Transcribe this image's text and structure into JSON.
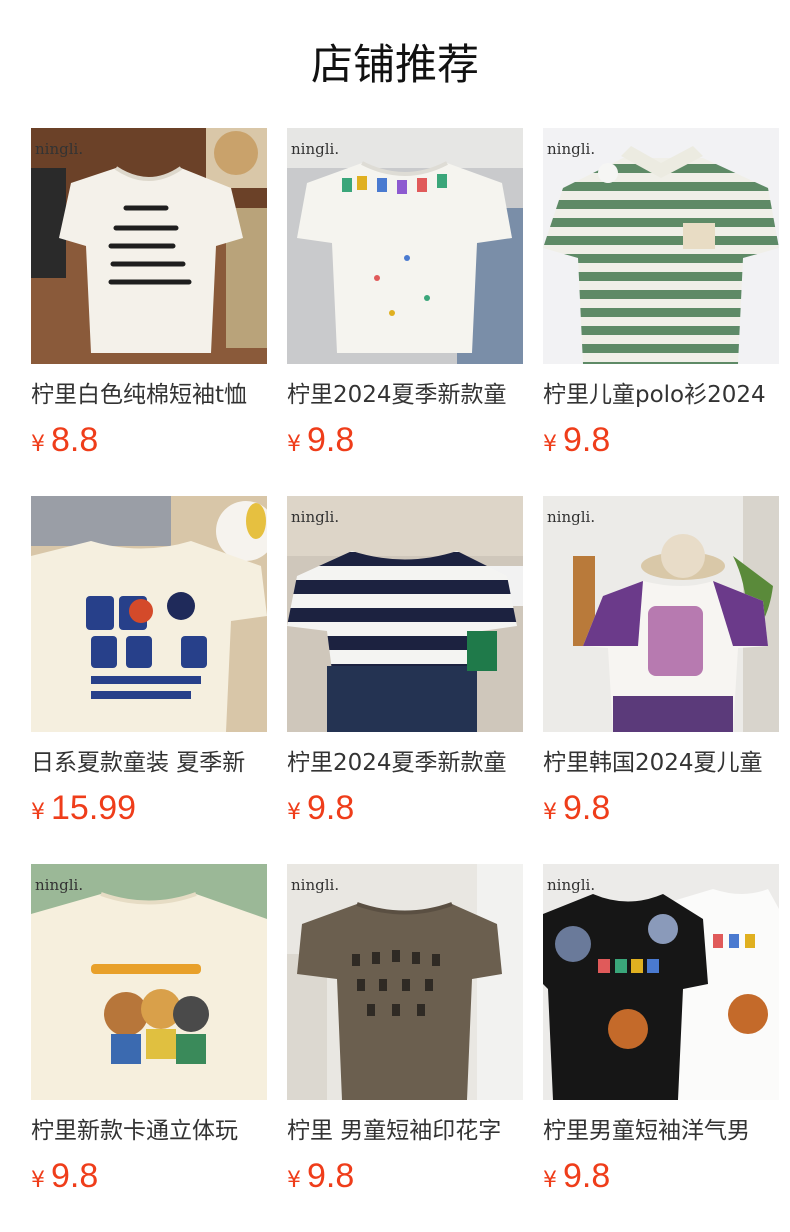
{
  "header": {
    "title": "店铺推荐"
  },
  "brand_mark": "ningli.",
  "currency": "¥",
  "products": [
    {
      "name": "柠里白色纯棉短袖t恤",
      "price": "8.8",
      "image": "white tee with chinese calligraphy"
    },
    {
      "name": "柠里2024夏季新款童",
      "price": "9.8",
      "image": "white tee with colorful letters"
    },
    {
      "name": "柠里儿童polo衫2024",
      "price": "9.8",
      "image": "green striped polo with bear patch"
    },
    {
      "name": "日系夏款童装 夏季新",
      "price": "15.99",
      "image": "cream tee with blue applique letters"
    },
    {
      "name": "柠里2024夏季新款童",
      "price": "9.8",
      "image": "navy striped tee with jeans"
    },
    {
      "name": "柠里韩国2024夏儿童",
      "price": "9.8",
      "image": "purple raglan tee with elephant"
    },
    {
      "name": "柠里新款卡通立体玩",
      "price": "9.8",
      "image": "cream tee with cartoon animals"
    },
    {
      "name": "柠里 男童短袖印花字",
      "price": "9.8",
      "image": "grey-brown tee with numbers"
    },
    {
      "name": "柠里男童短袖洋气男",
      "price": "9.8",
      "image": "black and white party animal tees"
    }
  ]
}
